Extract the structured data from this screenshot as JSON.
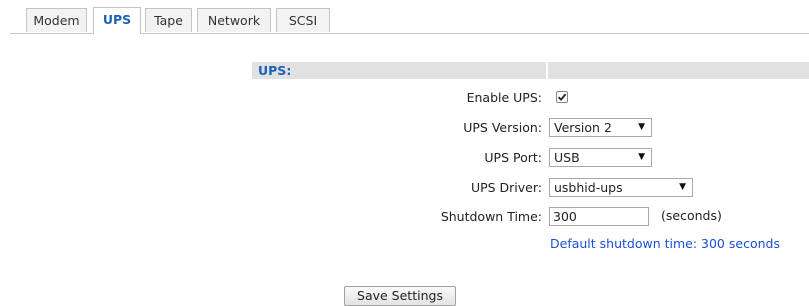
{
  "tabs": [
    {
      "label": "Modem",
      "active": false
    },
    {
      "label": "UPS",
      "active": true
    },
    {
      "label": "Tape",
      "active": false
    },
    {
      "label": "Network",
      "active": false
    },
    {
      "label": "SCSI",
      "active": false
    }
  ],
  "section": {
    "title": "UPS:"
  },
  "fields": {
    "enable_ups": {
      "label": "Enable UPS:",
      "checked": true
    },
    "ups_version": {
      "label": "UPS Version:",
      "value": "Version 2"
    },
    "ups_port": {
      "label": "UPS Port:",
      "value": "USB"
    },
    "ups_driver": {
      "label": "UPS Driver:",
      "value": "usbhid-ups"
    },
    "shutdown_time": {
      "label": "Shutdown Time:",
      "value": "300",
      "unit": "(seconds)",
      "hint": "Default shutdown time: 300 seconds"
    }
  },
  "actions": {
    "save_label": "Save Settings"
  },
  "colors": {
    "accent": "#1b63b7",
    "link": "#1b4fd6",
    "header_bg": "#e1e1e1"
  }
}
